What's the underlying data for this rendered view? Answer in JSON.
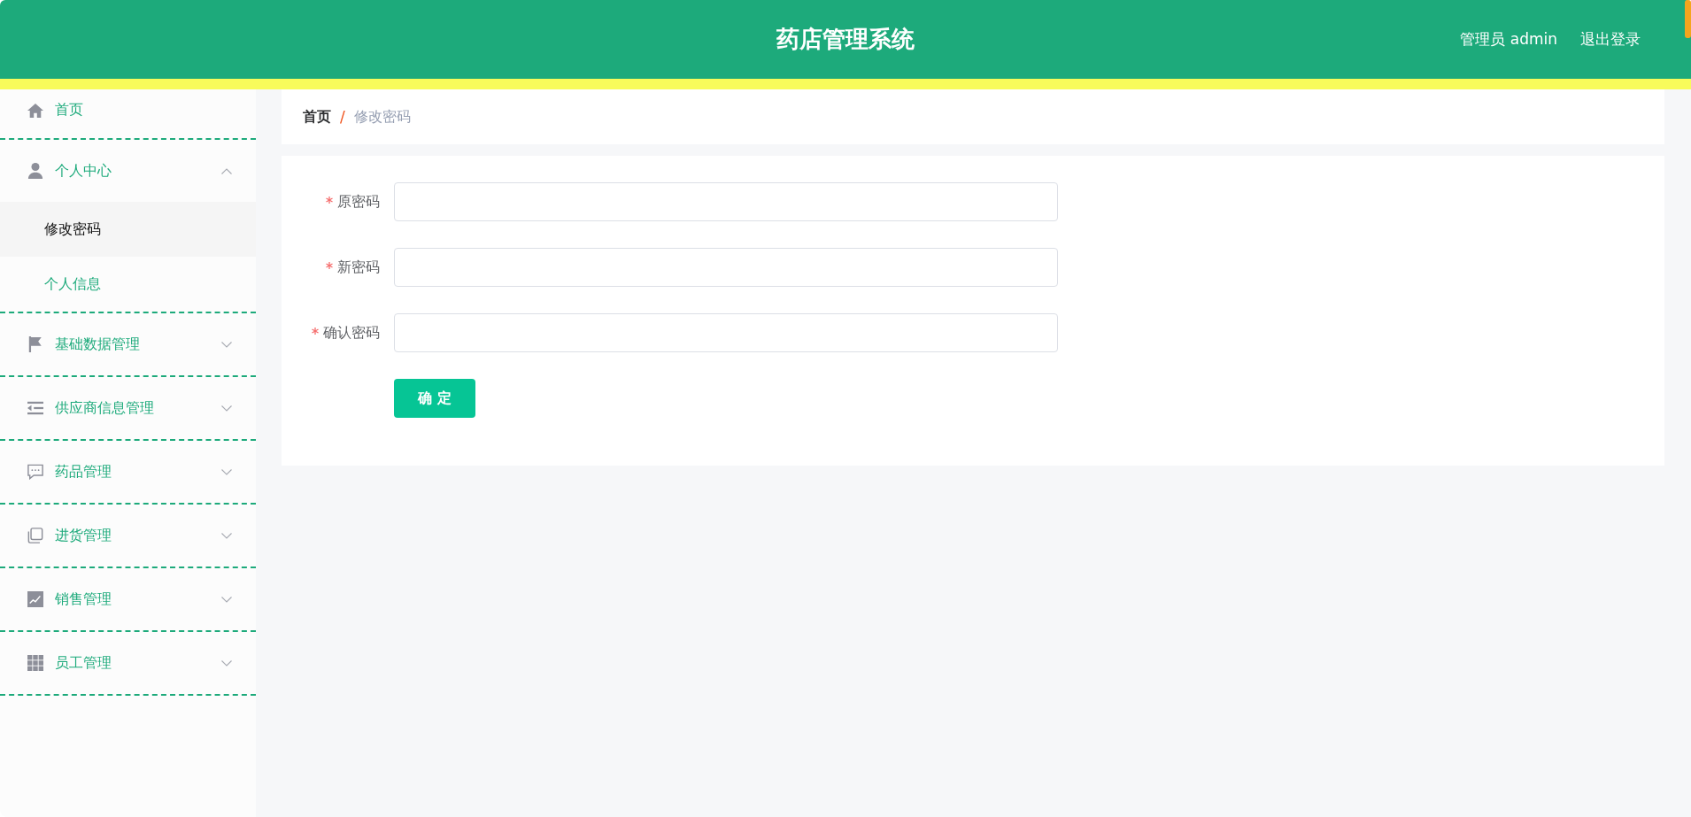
{
  "header": {
    "title": "药店管理系统",
    "user": "管理员 admin",
    "logout": "退出登录"
  },
  "sidebar": {
    "items": [
      {
        "kind": "link",
        "label": "首页"
      },
      {
        "kind": "submenu",
        "label": "个人中心",
        "expanded": true,
        "children": [
          {
            "label": "修改密码",
            "selected": true
          },
          {
            "label": "个人信息",
            "selected": false
          }
        ]
      },
      {
        "kind": "submenu",
        "label": "基础数据管理",
        "expanded": false
      },
      {
        "kind": "submenu",
        "label": "供应商信息管理",
        "expanded": false
      },
      {
        "kind": "submenu",
        "label": "药品管理",
        "expanded": false
      },
      {
        "kind": "submenu",
        "label": "进货管理",
        "expanded": false
      },
      {
        "kind": "submenu",
        "label": "销售管理",
        "expanded": false
      },
      {
        "kind": "submenu",
        "label": "员工管理",
        "expanded": false
      }
    ]
  },
  "breadcrumb": {
    "home": "首页",
    "separator": "/",
    "current": "修改密码"
  },
  "form": {
    "fields": [
      {
        "label": "原密码",
        "required": true
      },
      {
        "label": "新密码",
        "required": true
      },
      {
        "label": "确认密码",
        "required": true
      }
    ],
    "submit": "确 定"
  }
}
